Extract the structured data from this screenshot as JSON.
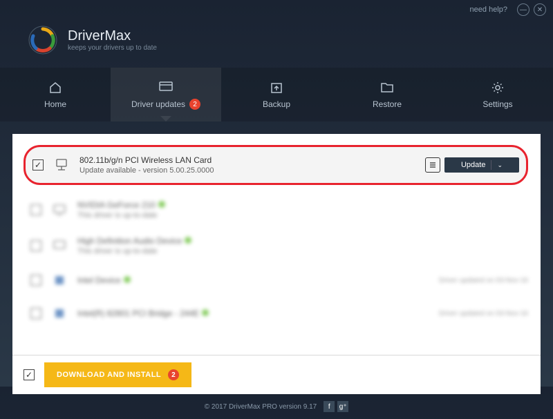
{
  "titlebar": {
    "help": "need help?"
  },
  "brand": {
    "name": "DriverMax",
    "tagline": "keeps your drivers up to date"
  },
  "nav": {
    "home": "Home",
    "updates": "Driver updates",
    "updates_badge": "2",
    "backup": "Backup",
    "restore": "Restore",
    "settings": "Settings"
  },
  "drivers": {
    "highlighted": {
      "name": "802.11b/g/n PCI Wireless LAN Card",
      "status": "Update available - version 5.00.25.0000",
      "action": "Update"
    },
    "rows": [
      {
        "name": "NVIDIA GeForce 210",
        "status": "This driver is up-to-date"
      },
      {
        "name": "High Definition Audio Device",
        "status": "This driver is up-to-date"
      },
      {
        "name": "Intel Device",
        "status": "",
        "right": "Driver updated on 03-Nov-16"
      },
      {
        "name": "Intel(R) 82801 PCI Bridge - 244E",
        "status": "",
        "right": "Driver updated on 03-Nov-16"
      }
    ]
  },
  "bottom": {
    "download": "DOWNLOAD AND INSTALL",
    "download_badge": "2"
  },
  "footer": {
    "copyright": "© 2017 DriverMax PRO version 9.17"
  }
}
